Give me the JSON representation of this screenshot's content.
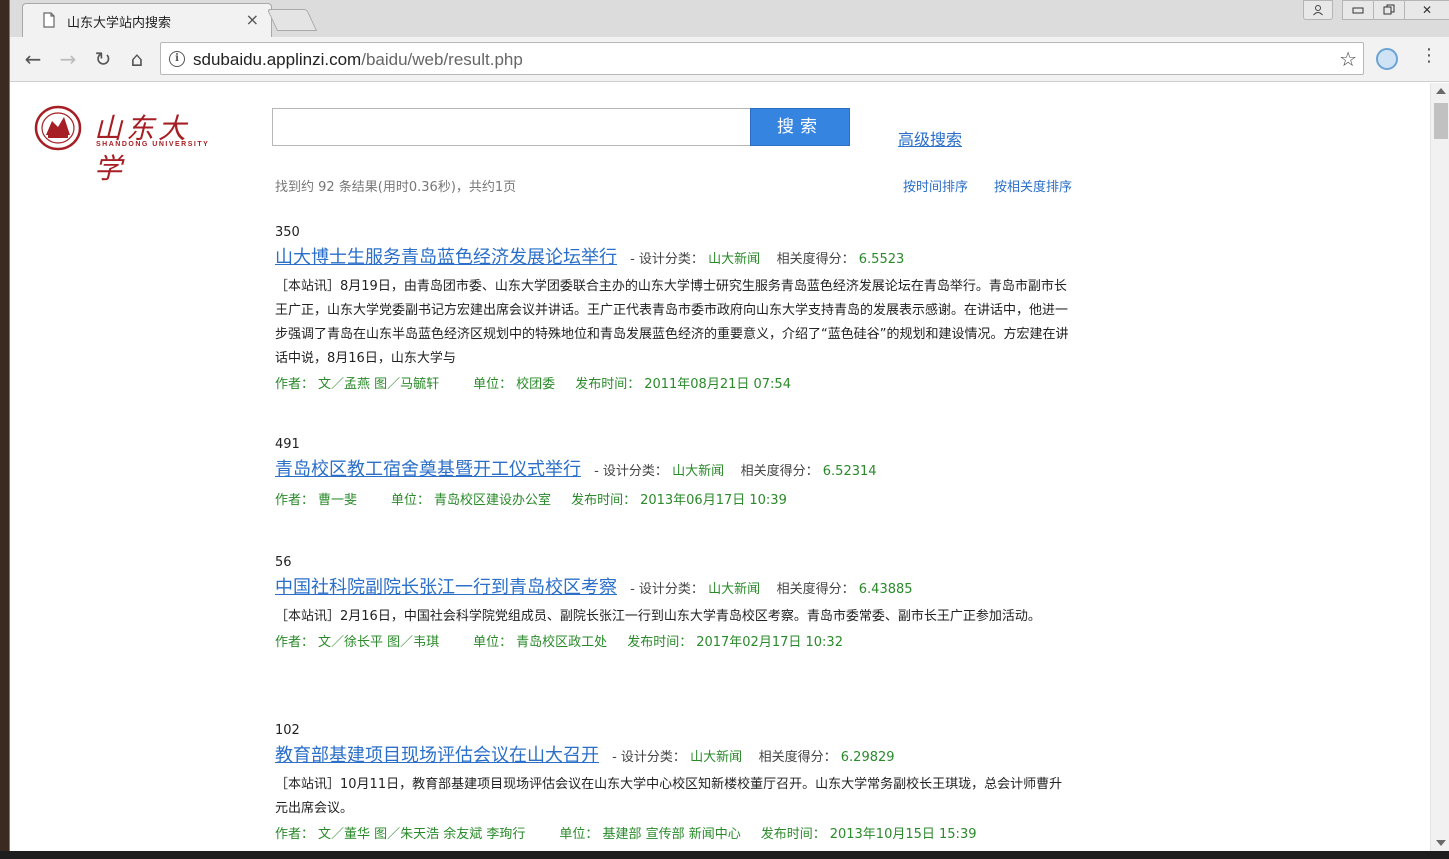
{
  "browser": {
    "tab_title": "山东大学站内搜索",
    "tab_close": "×",
    "url_host": "sdubaidu.applinzi.com",
    "url_path": "/baidu/web/result.php",
    "back": "←",
    "forward": "→",
    "reload": "↻",
    "home": "⌂",
    "star": "☆",
    "menu": "⋮",
    "win_user": "👤",
    "win_min": "▭",
    "win_restore": "❐",
    "win_close": "✕",
    "info": "i"
  },
  "logo": {
    "script_text": "山东大学",
    "english_text": "SHANDONG UNIVERSITY"
  },
  "search": {
    "input_value": "",
    "button_label": "搜索",
    "advanced_link": "高级搜索"
  },
  "stats_text": "找到约 92 条结果(用时0.36秒)，共约1页",
  "sort": {
    "by_time": "按时间排序",
    "by_relevance": "按相关度排序"
  },
  "labels": {
    "category": "设计分类：",
    "score": "相关度得分：",
    "author": "作者：",
    "unit": "单位：",
    "published": "发布时间："
  },
  "results": [
    {
      "id": "350",
      "title": "山大博士生服务青岛蓝色经济发展论坛举行",
      "category": "山大新闻",
      "score": "6.5523",
      "snippet": "［本站讯］8月19日，由青岛团市委、山东大学团委联合主办的山东大学博士研究生服务青岛蓝色经济发展论坛在青岛举行。青岛市副市长王广正，山东大学党委副书记方宏建出席会议并讲话。王广正代表青岛市委市政府向山东大学支持青岛的发展表示感谢。在讲话中，他进一步强调了青岛在山东半岛蓝色经济区规划中的特殊地位和青岛发展蓝色经济的重要意义，介绍了“蓝色硅谷”的规划和建设情况。方宏建在讲话中说，8月16日，山东大学与",
      "author": "文／孟燕 图／马毓轩",
      "unit": "校团委",
      "published": "2011年08月21日 07:54"
    },
    {
      "id": "491",
      "title": "青岛校区教工宿舍奠基暨开工仪式举行",
      "category": "山大新闻",
      "score": "6.52314",
      "snippet": "",
      "author": "曹一斐",
      "unit": "青岛校区建设办公室",
      "published": "2013年06月17日 10:39"
    },
    {
      "id": "56",
      "title": "中国社科院副院长张江一行到青岛校区考察",
      "category": "山大新闻",
      "score": "6.43885",
      "snippet": "［本站讯］2月16日，中国社会科学院党组成员、副院长张江一行到山东大学青岛校区考察。青岛市委常委、副市长王广正参加活动。",
      "author": "文／徐长平 图／韦琪",
      "unit": "青岛校区政工处",
      "published": "2017年02月17日 10:32"
    },
    {
      "id": "102",
      "title": "教育部基建项目现场评估会议在山大召开",
      "category": "山大新闻",
      "score": "6.29829",
      "snippet": "［本站讯］10月11日，教育部基建项目现场评估会议在山东大学中心校区知新楼校董厅召开。山东大学常务副校长王琪珑，总会计师曹升元出席会议。",
      "author": "文／董华 图／朱天浩 余友斌 李珣行",
      "unit": "基建部 宣传部 新闻中心",
      "published": "2013年10月15日 15:39"
    }
  ]
}
